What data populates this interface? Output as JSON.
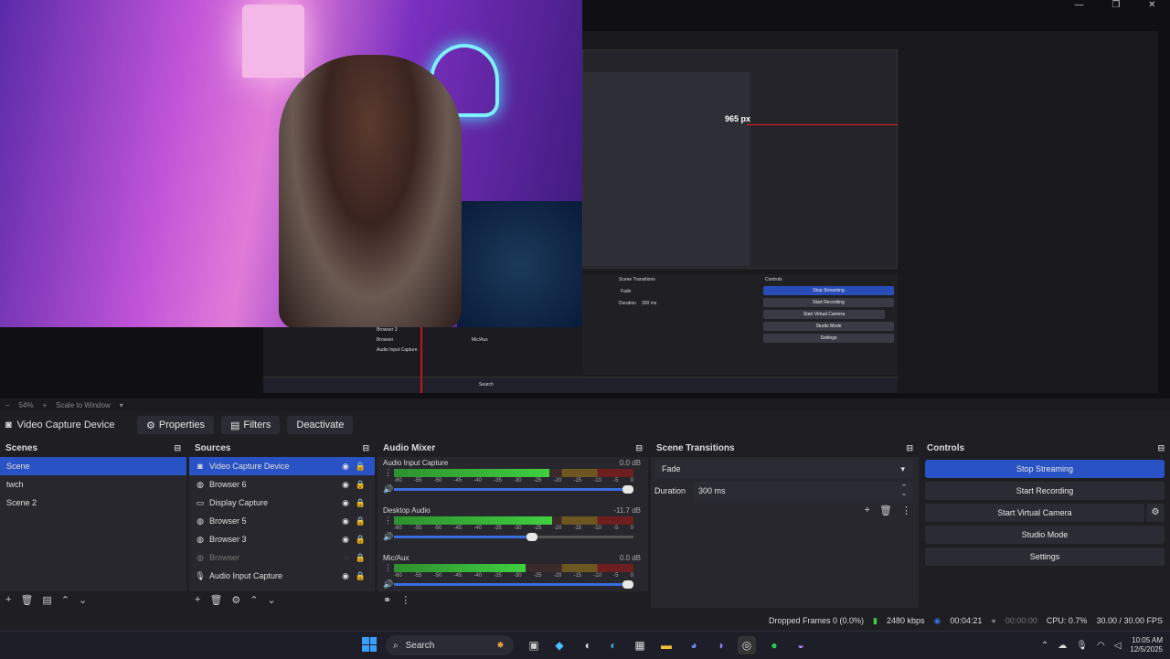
{
  "preview": {
    "nested_px_label": "965 px",
    "zoom_percent": "54%",
    "zoom_mode": "Scale to Window",
    "nested": {
      "scene_transitions_title": "Scene Transitions",
      "controls_title": "Controls",
      "fade": "Fade",
      "duration_label": "Duration",
      "duration_value": "300 ms",
      "stop_streaming": "Stop Streaming",
      "start_recording": "Start Recording",
      "start_virtual_camera": "Start Virtual Camera",
      "studio_mode": "Studio Mode",
      "settings": "Settings",
      "source_items": [
        "Browser 3",
        "Browser",
        "Audio Input Capture"
      ],
      "mixer_item": "Mic/Aux",
      "search": "Search"
    }
  },
  "context": {
    "source_name": "Video Capture Device",
    "properties": "Properties",
    "filters": "Filters",
    "deactivate": "Deactivate"
  },
  "scenes": {
    "title": "Scenes",
    "items": [
      "Scene",
      "twch",
      "Scene 2"
    ]
  },
  "sources": {
    "title": "Sources",
    "items": [
      "Video Capture Device",
      "Browser 6",
      "Display Capture",
      "Browser 5",
      "Browser 3",
      "Browser",
      "Audio Input Capture"
    ]
  },
  "mixer": {
    "title": "Audio Mixer",
    "channels": [
      {
        "name": "Audio Input Capture",
        "db": "0.0 dB",
        "level": 0.65,
        "volume": 1.0
      },
      {
        "name": "Desktop Audio",
        "db": "-11.7 dB",
        "level": 0.66,
        "volume": 0.6
      },
      {
        "name": "Mic/Aux",
        "db": "0.0 dB",
        "level": 0.55,
        "volume": 1.0
      }
    ],
    "ticks": [
      "-60",
      "-55",
      "-50",
      "-45",
      "-40",
      "-35",
      "-30",
      "-25",
      "-20",
      "-15",
      "-10",
      "-5",
      "0"
    ]
  },
  "transitions": {
    "title": "Scene Transitions",
    "selected": "Fade",
    "duration_label": "Duration",
    "duration_value": "300 ms"
  },
  "controls": {
    "title": "Controls",
    "stop_streaming": "Stop Streaming",
    "start_recording": "Start Recording",
    "start_virtual_camera": "Start Virtual Camera",
    "studio_mode": "Studio Mode",
    "settings": "Settings"
  },
  "status": {
    "dropped": "Dropped Frames 0 (0.0%)",
    "bitrate": "2480 kbps",
    "stream_time": "00:04:21",
    "rec_time": "00:00:00",
    "cpu": "CPU: 0.7%",
    "fps": "30.00 / 30.00 FPS"
  },
  "taskbar": {
    "search": "Search",
    "time": "10:05 AM",
    "date": "12/5/2025"
  },
  "colors": {
    "accent": "#2952c4",
    "panel": "#27272d",
    "background": "#1f1f23"
  }
}
